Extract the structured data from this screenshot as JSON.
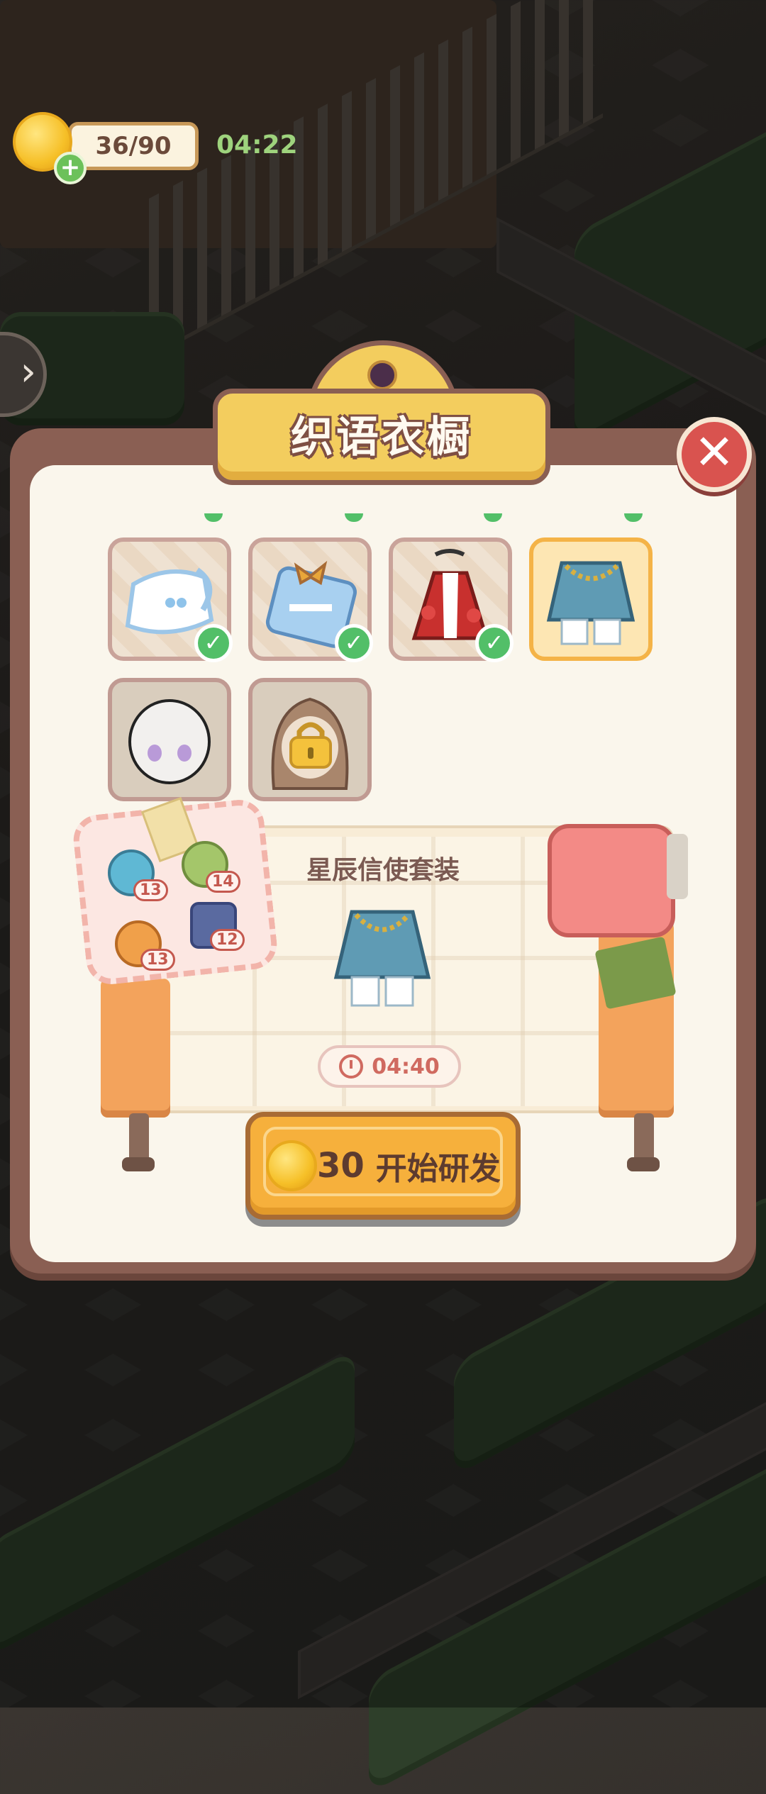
{
  "hud": {
    "energy": "36/90",
    "timer": "04:22"
  },
  "panel": {
    "title": "织语衣橱",
    "items": [
      {
        "name": "lace-apron",
        "unlocked": true
      },
      {
        "name": "blue-bow-outfit",
        "unlocked": true
      },
      {
        "name": "red-rose-dress",
        "unlocked": true
      },
      {
        "name": "star-messenger-suit",
        "selected": true
      },
      {
        "name": "base-face",
        "unlocked": true
      },
      {
        "name": "long-hair",
        "locked": true
      }
    ],
    "materials": [
      {
        "name": "yarn-ball",
        "count": "13"
      },
      {
        "name": "scissors",
        "count": "14"
      },
      {
        "name": "button",
        "count": "13"
      },
      {
        "name": "fabric-roll",
        "count": "12"
      }
    ],
    "project": {
      "title": "星辰信使套装",
      "time": "04:40"
    },
    "start": {
      "cost": "30",
      "label": "开始研发"
    }
  }
}
